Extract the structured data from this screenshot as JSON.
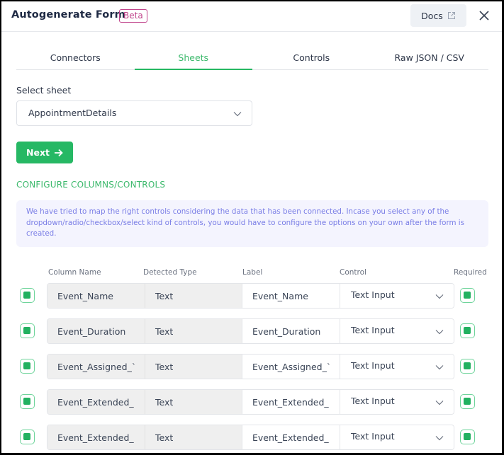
{
  "header": {
    "title": "Autogenerate Form",
    "badge": "Beta",
    "docs_label": "Docs",
    "docs_icon": "external-link-icon",
    "close_icon": "close-icon"
  },
  "tabs": [
    {
      "label": "Connectors",
      "active": false
    },
    {
      "label": "Sheets",
      "active": true
    },
    {
      "label": "Controls",
      "active": false
    },
    {
      "label": "Raw JSON / CSV",
      "active": false
    }
  ],
  "sheet": {
    "label": "Select sheet",
    "selected": "AppointmentDetails"
  },
  "next_button": {
    "label": "Next",
    "icon": "arrow-right-icon"
  },
  "configure": {
    "title": "CONFIGURE COLUMNS/CONTROLS",
    "info": "We have tried to map the right controls considering the data that has been connected. Incase you select any of the dropdown/radio/checkbox/select kind of controls, you would have to configure the options on your own after the form is created."
  },
  "columns": {
    "column_name": "Column Name",
    "detected_type": "Detected Type",
    "label": "Label",
    "control": "Control",
    "required": "Required"
  },
  "rows": [
    {
      "included": true,
      "column_name": "Event_Name",
      "type": "Text",
      "label": "Event_Name",
      "control": "Text Input",
      "required": true
    },
    {
      "included": true,
      "column_name": "Event_Duration",
      "type": "Text",
      "label": "Event_Duration",
      "control": "Text Input",
      "required": true
    },
    {
      "included": true,
      "column_name": "Event_Assigned_`",
      "type": "Text",
      "label": "Event_Assigned_`",
      "control": "Text Input",
      "required": true
    },
    {
      "included": true,
      "column_name": "Event_Extended_",
      "type": "Text",
      "label": "Event_Extended_",
      "control": "Text Input",
      "required": true
    },
    {
      "included": true,
      "column_name": "Event_Extended_",
      "type": "Text",
      "label": "Event_Extended_",
      "control": "Text Input",
      "required": true
    }
  ],
  "colors": {
    "accent": "#26b864",
    "beta": "#c0428a",
    "info_text": "#7a7ee6",
    "info_bg": "#f4f4fe"
  }
}
